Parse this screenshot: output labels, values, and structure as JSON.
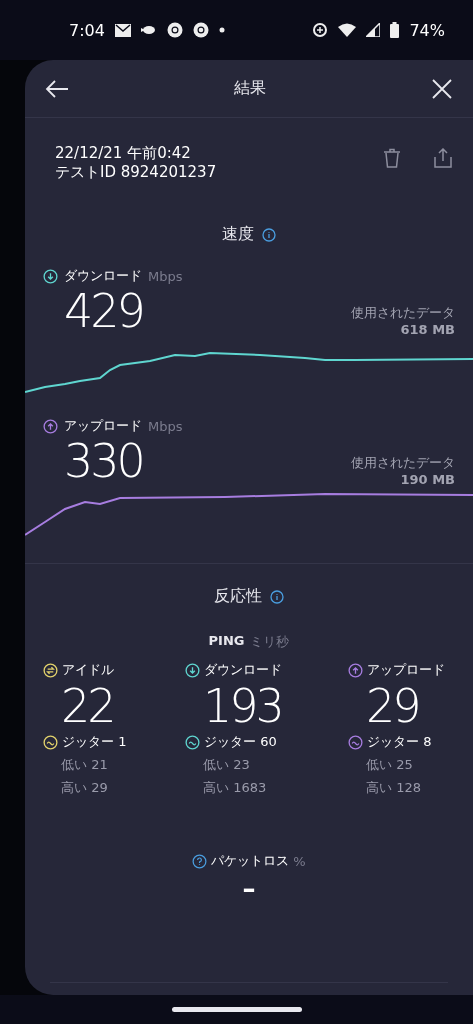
{
  "status_bar": {
    "time": "7:04",
    "battery": "74%"
  },
  "header": {
    "title": "結果"
  },
  "test": {
    "datetime": "22/12/21 午前0:42",
    "test_id": "テストID 8924201237"
  },
  "speed": {
    "title": "速度",
    "metrics": [
      {
        "kind": "download",
        "label": "ダウンロード",
        "unit": "Mbps",
        "value": "429",
        "data_label": "使用されたデータ",
        "data_value": "618 MB",
        "color": "#5fd6d0"
      },
      {
        "kind": "upload",
        "label": "アップロード",
        "unit": "Mbps",
        "value": "330",
        "data_label": "使用されたデータ",
        "data_value": "190 MB",
        "color": "#a77de0"
      }
    ]
  },
  "responsiveness": {
    "title": "反応性",
    "ping_label": "PING",
    "ping_unit": "ミリ秒",
    "columns": [
      {
        "kind": "idle",
        "label": "アイドル",
        "value": "22",
        "jitter": "ジッター 1",
        "low": "低い 21",
        "high": "高い 29",
        "color": "#e3d36c"
      },
      {
        "kind": "download",
        "label": "ダウンロード",
        "value": "193",
        "jitter": "ジッター 60",
        "low": "低い 23",
        "high": "高い 1683",
        "color": "#5fd6d0"
      },
      {
        "kind": "upload",
        "label": "アップロード",
        "value": "29",
        "jitter": "ジッター 8",
        "low": "低い 25",
        "high": "高い 128",
        "color": "#a77de0"
      }
    ]
  },
  "packet_loss": {
    "label": "パケットロス",
    "unit": "%",
    "value": "–"
  }
}
